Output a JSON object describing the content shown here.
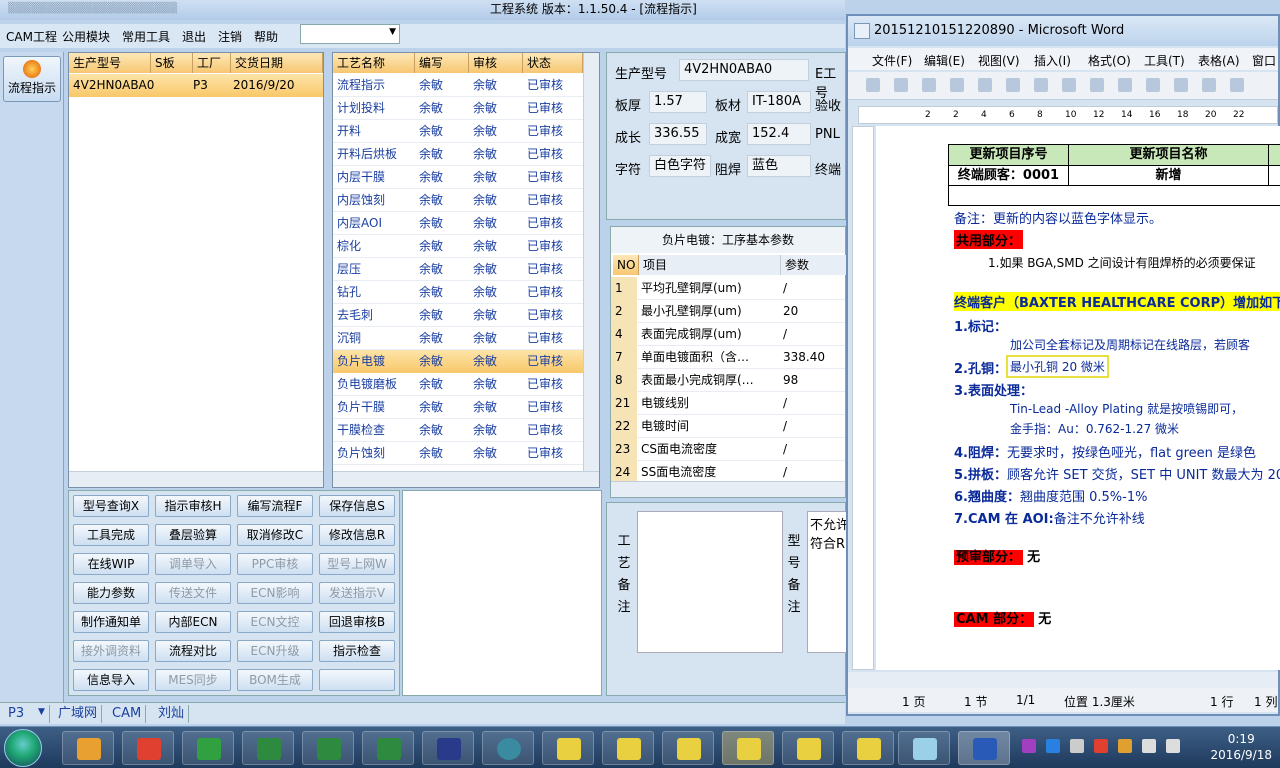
{
  "app": {
    "title": "工程系统  版本：1.1.50.4 - [流程指示]",
    "menu": [
      "CAM工程",
      "公用模块",
      "常用工具",
      "退出",
      "注销",
      "帮助"
    ],
    "flow_button": "流程指示"
  },
  "grid1": {
    "headers": [
      "生产型号",
      "S板",
      "工厂",
      "交货日期"
    ],
    "rows": [
      [
        "4V2HN0ABA0",
        "",
        "P3",
        "2016/9/20"
      ]
    ]
  },
  "grid2": {
    "headers": [
      "工艺名称",
      "编写",
      "审核",
      "状态"
    ],
    "rows": [
      [
        "流程指示",
        "余敏",
        "余敏",
        "已审核"
      ],
      [
        "计划投料",
        "余敏",
        "余敏",
        "已审核"
      ],
      [
        "开料",
        "余敏",
        "余敏",
        "已审核"
      ],
      [
        "开料后烘板",
        "余敏",
        "余敏",
        "已审核"
      ],
      [
        "内层干膜",
        "余敏",
        "余敏",
        "已审核"
      ],
      [
        "内层蚀刻",
        "余敏",
        "余敏",
        "已审核"
      ],
      [
        "内层AOI",
        "余敏",
        "余敏",
        "已审核"
      ],
      [
        "棕化",
        "余敏",
        "余敏",
        "已审核"
      ],
      [
        "层压",
        "余敏",
        "余敏",
        "已审核"
      ],
      [
        "钻孔",
        "余敏",
        "余敏",
        "已审核"
      ],
      [
        "去毛刺",
        "余敏",
        "余敏",
        "已审核"
      ],
      [
        "沉铜",
        "余敏",
        "余敏",
        "已审核"
      ],
      [
        "负片电镀",
        "余敏",
        "余敏",
        "已审核"
      ],
      [
        "负电镀磨板",
        "余敏",
        "余敏",
        "已审核"
      ],
      [
        "负片干膜",
        "余敏",
        "余敏",
        "已审核"
      ],
      [
        "干膜检查",
        "余敏",
        "余敏",
        "已审核"
      ],
      [
        "负片蚀刻",
        "余敏",
        "余敏",
        "已审核"
      ]
    ],
    "selected_index": 12
  },
  "buttons": [
    {
      "label": "型号查询X",
      "enabled": true
    },
    {
      "label": "指示审核H",
      "enabled": true
    },
    {
      "label": "编写流程F",
      "enabled": true
    },
    {
      "label": "保存信息S",
      "enabled": true
    },
    {
      "label": "工具完成",
      "enabled": true
    },
    {
      "label": "叠层验算",
      "enabled": true
    },
    {
      "label": "取消修改C",
      "enabled": true
    },
    {
      "label": "修改信息R",
      "enabled": true
    },
    {
      "label": "在线WIP",
      "enabled": true
    },
    {
      "label": "调单导入",
      "enabled": false
    },
    {
      "label": "PPC审核",
      "enabled": false
    },
    {
      "label": "型号上网W",
      "enabled": false
    },
    {
      "label": "能力参数",
      "enabled": true
    },
    {
      "label": "传送文件",
      "enabled": false
    },
    {
      "label": "ECN影响",
      "enabled": false
    },
    {
      "label": "发送指示V",
      "enabled": false
    },
    {
      "label": "制作通知单",
      "enabled": true
    },
    {
      "label": "内部ECN",
      "enabled": true
    },
    {
      "label": "ECN文控",
      "enabled": false
    },
    {
      "label": "回退审核B",
      "enabled": true
    },
    {
      "label": "接外调资料",
      "enabled": false
    },
    {
      "label": "流程对比",
      "enabled": true
    },
    {
      "label": "ECN升级",
      "enabled": false
    },
    {
      "label": "指示检查",
      "enabled": true
    },
    {
      "label": "信息导入",
      "enabled": true
    },
    {
      "label": "MES同步",
      "enabled": false
    },
    {
      "label": "BOM生成",
      "enabled": false
    },
    {
      "label": "",
      "enabled": true
    }
  ],
  "info": {
    "model_label": "生产型号",
    "model": "4V2HN0ABA0",
    "e_label": "E工号",
    "thick_label": "板厚",
    "thick": "1.57",
    "mat_label": "板材",
    "mat": "IT-180A",
    "verify_label": "验收",
    "len_label": "成长",
    "len": "336.55",
    "wid_label": "成宽",
    "wid": "152.4",
    "pnl_label": "PNL",
    "char_label": "字符",
    "char": "白色字符",
    "mask_label": "阻焊",
    "mask": "蓝色",
    "end_label": "终端"
  },
  "params": {
    "title": "负片电镀：工序基本参数",
    "headers": [
      "NO",
      "项目",
      "参数"
    ],
    "rows": [
      [
        "1",
        "平均孔壁铜厚(um)",
        "/"
      ],
      [
        "2",
        "最小孔壁铜厚(um)",
        "20"
      ],
      [
        "4",
        "表面完成铜厚(um)",
        "/"
      ],
      [
        "7",
        "单面电镀面积（含…",
        "338.40"
      ],
      [
        "8",
        "表面最小完成铜厚(…",
        "98"
      ],
      [
        "21",
        "电镀线别",
        "/"
      ],
      [
        "22",
        "电镀时间",
        "/"
      ],
      [
        "23",
        "CS面电流密度",
        "/"
      ],
      [
        "24",
        "SS面电流密度",
        "/"
      ]
    ]
  },
  "remarks": {
    "proc_label": "工艺备注",
    "model_label": "型号备注",
    "model_text": "不允许…\n符合R…"
  },
  "status_tabs": [
    "P3",
    "广域网",
    "CAM",
    "刘灿"
  ],
  "word": {
    "title": "20151210151220890 - Microsoft Word",
    "menu": [
      "文件(F)",
      "编辑(E)",
      "视图(V)",
      "插入(I)",
      "格式(O)",
      "工具(T)",
      "表格(A)",
      "窗口"
    ],
    "ruler": [
      "2",
      "2",
      "4",
      "6",
      "8",
      "10",
      "12",
      "14",
      "16",
      "18",
      "20",
      "22"
    ],
    "table_h1": "更新项目序号",
    "table_h2": "更新项目名称",
    "table_c1": "终端顾客：0001",
    "table_c2": "新增",
    "note": "备注：更新的内容以蓝色字体显示。",
    "common": "共用部分：",
    "common_1": "1.如果 BGA,SMD 之间设计有阻焊桥的必须要保证",
    "customer": "终端客户（BAXTER HEALTHCARE CORP）增加如下",
    "mark_t": "1.标记：",
    "mark_v": "加公司全套标记及周期标记在线路层，若顾客",
    "hole_t": "2.孔铜：",
    "hole_v": "最小孔铜 20 微米",
    "surf_t": "3.表面处理：",
    "surf_v1": "Tin-Lead -Alloy Plating 就是按喷锡即可，",
    "surf_v2": "金手指：Au：0.762-1.27 微米",
    "mask_t": "4.阻焊：",
    "mask_v": "无要求时，按绿色哑光，flat green 是绿色",
    "pnl_t": "5.拼板：",
    "pnl_v": "顾客允许 SET 交货，SET 中 UNIT 数最大为 20",
    "warp_t": "6.翘曲度：",
    "warp_v": "翘曲度范围 0.5%-1%",
    "aoi_t": "7.CAM 在 AOI:",
    "aoi_v": "备注不允许补线",
    "pre": "预审部分：",
    "pre_v": "无",
    "cam": "CAM 部分：",
    "cam_v": "无",
    "status": [
      "1 页",
      "1 节",
      "1/1",
      "位置 1.3厘米",
      "1 行",
      "1 列"
    ]
  },
  "clock": {
    "time": "0:19",
    "date": "2016/9/18"
  }
}
